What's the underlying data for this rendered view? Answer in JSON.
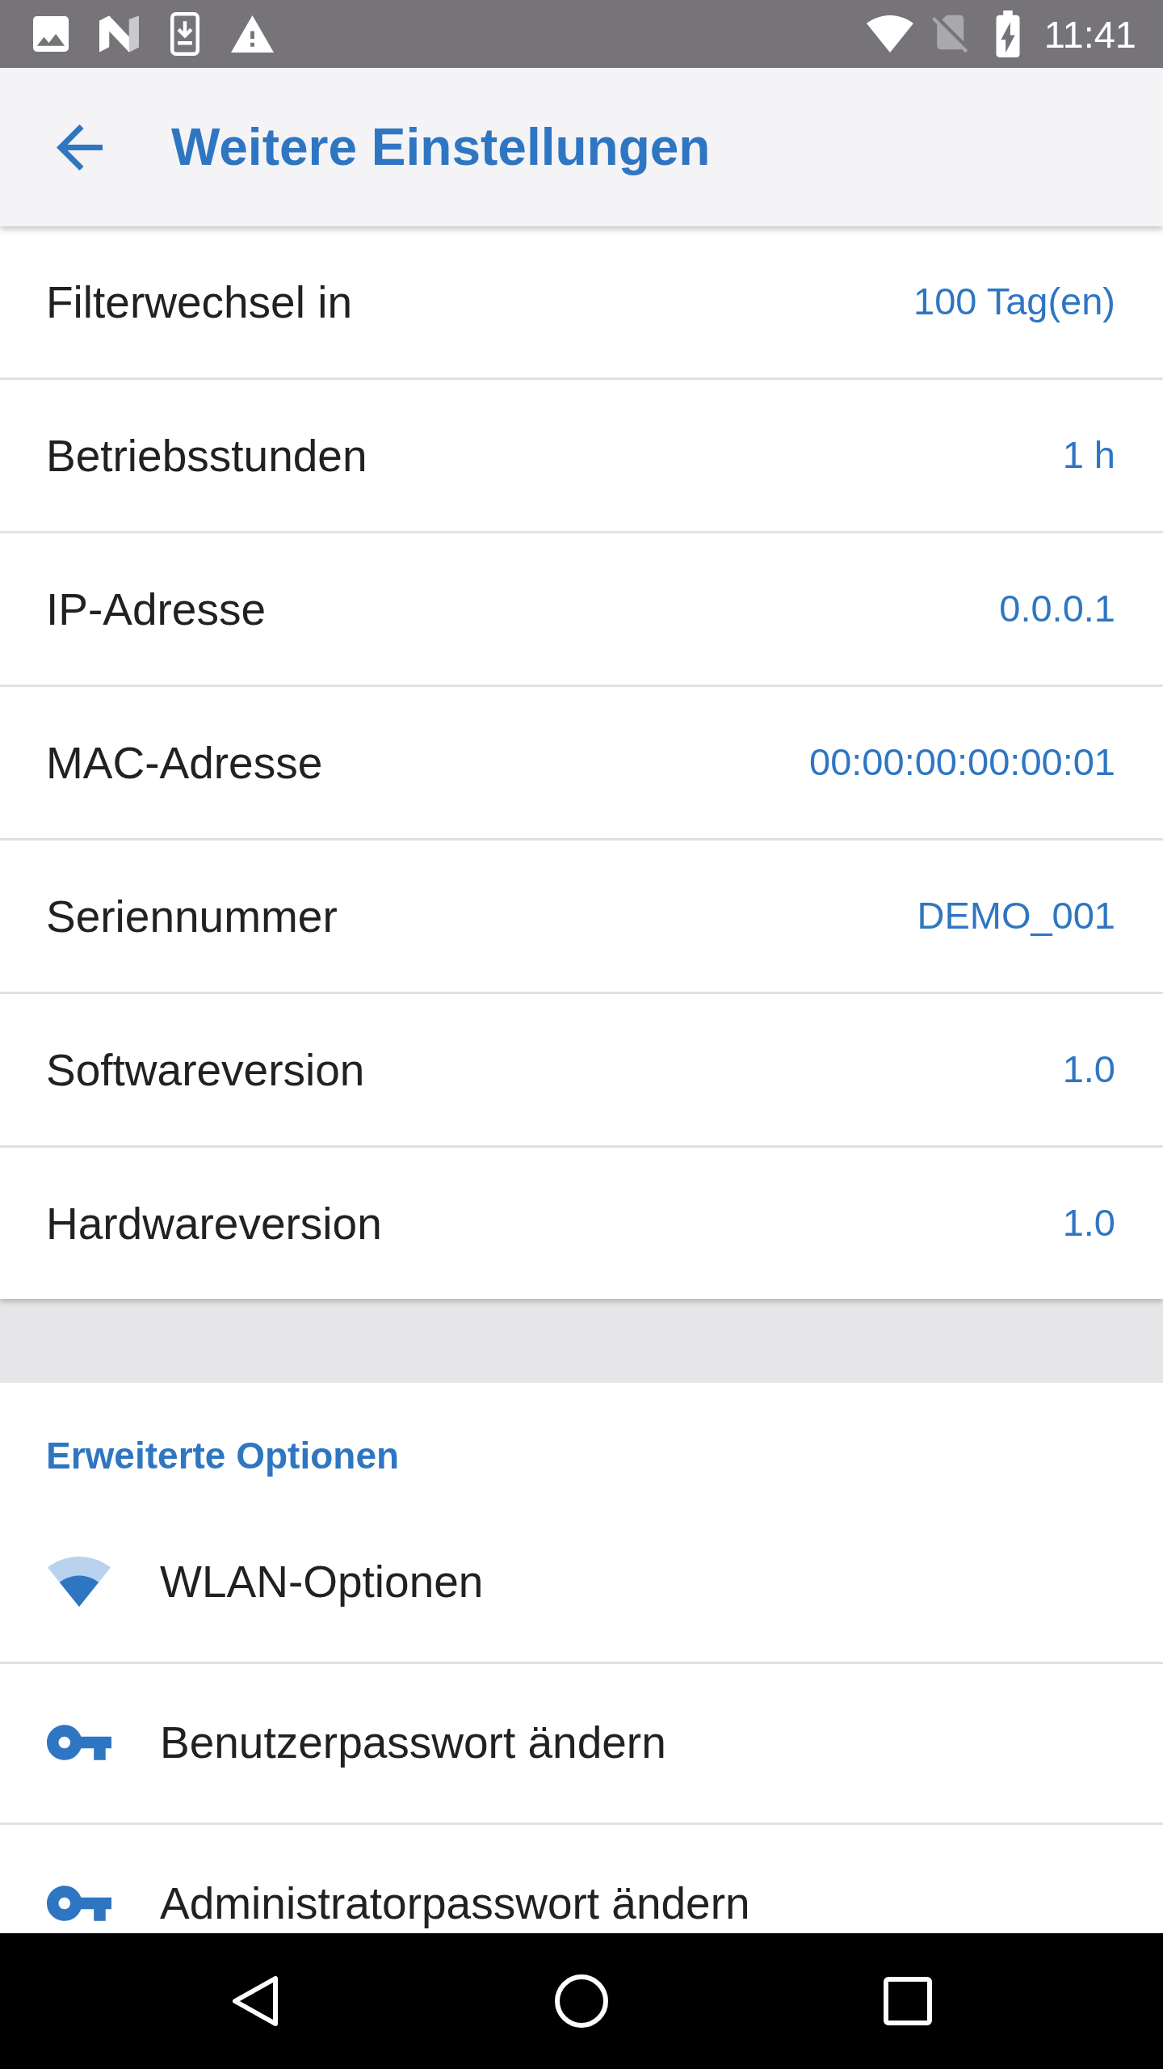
{
  "status_bar": {
    "time": "11:41"
  },
  "app_bar": {
    "title": "Weitere Einstellungen"
  },
  "info_rows": [
    {
      "label": "Filterwechsel in",
      "value": "100 Tag(en)"
    },
    {
      "label": "Betriebsstunden",
      "value": "1 h"
    },
    {
      "label": "IP-Adresse",
      "value": "0.0.0.1"
    },
    {
      "label": "MAC-Adresse",
      "value": "00:00:00:00:00:01"
    },
    {
      "label": "Seriennummer",
      "value": "DEMO_001"
    },
    {
      "label": "Softwareversion",
      "value": "1.0"
    },
    {
      "label": "Hardwareversion",
      "value": "1.0"
    }
  ],
  "advanced_options": {
    "title": "Erweiterte Optionen",
    "items": [
      {
        "kind": "wifi",
        "label": "WLAN-Optionen"
      },
      {
        "kind": "key",
        "label": "Benutzerpasswort ändern"
      },
      {
        "kind": "key",
        "label": "Administratorpasswort ändern"
      }
    ]
  }
}
